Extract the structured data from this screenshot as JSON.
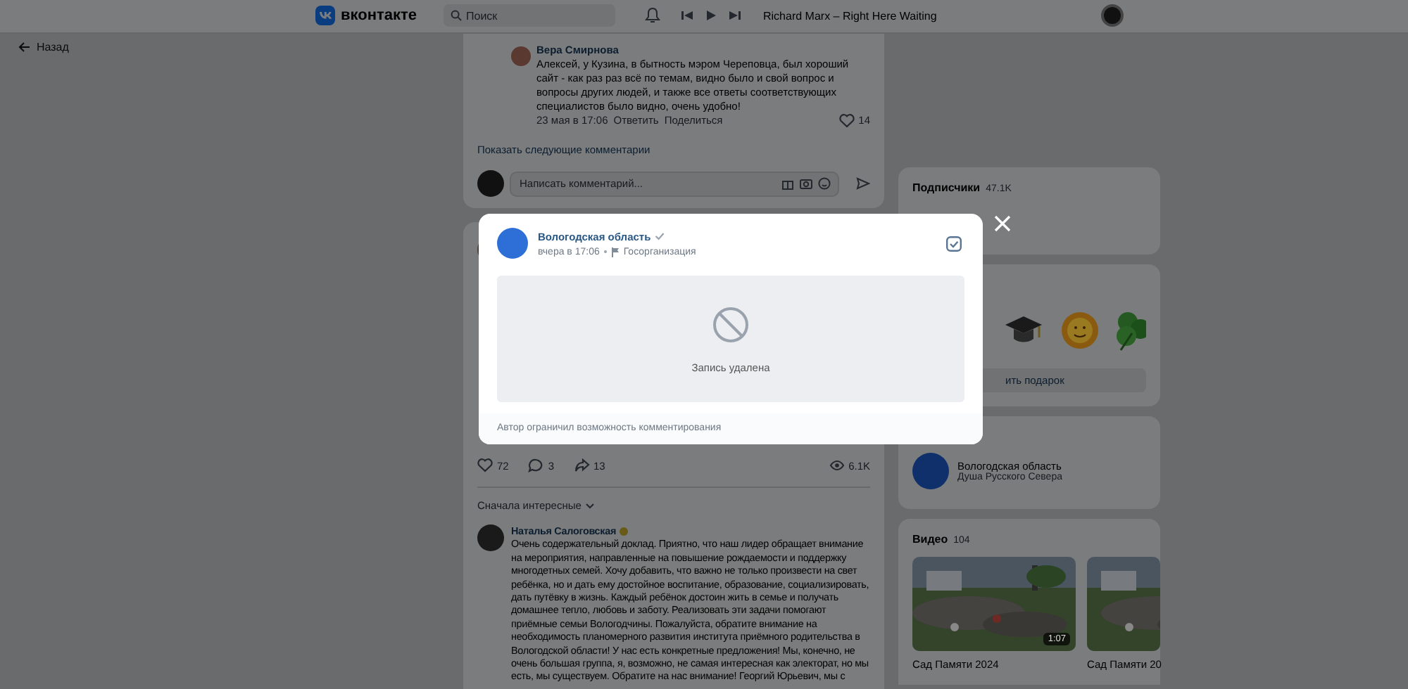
{
  "header": {
    "logo": "вконтакте",
    "search": {
      "placeholder": "Поиск"
    },
    "track": "Richard Marx – Right Here Waiting"
  },
  "back_link": "Назад",
  "reply": {
    "author": "Вера Смирнова",
    "text": "Алексей, у Кузина, в бытность мэром Череповца, был хороший сайт - как раз раз всё по темам, видно было и свой вопрос и вопросы других людей, и также все ответы соответствующих специалистов было видно, очень удобно!",
    "date": "23 мая в 17:06",
    "actions": [
      "Ответить",
      "Поделиться"
    ],
    "likes": "14"
  },
  "show_more": "Показать следующие комментарии",
  "comment_field": {
    "placeholder": "Написать комментарий..."
  },
  "post_stats": [
    {
      "kind": "like",
      "count": "72"
    },
    {
      "kind": "comment",
      "count": "3"
    },
    {
      "kind": "share",
      "count": "13"
    },
    {
      "kind": "views",
      "count": "6.1K"
    }
  ],
  "sort": "Сначала интересные",
  "comment": {
    "author": "Наталья Салоговская",
    "text": "Очень содержательный доклад. Приятно, что наш лидер обращает внимание на мероприятия, направленные на повышение рождаемости и поддержку многодетных семей. Хочу добавить, что важно не только произвести на свет ребёнка, но и дать ему достойное воспитание, образование, социализировать, дать путёвку в жизнь. Каждый ребёнок достоин жить в семье и получать домашнее тепло, любовь и заботу. Реализовать эти задачи помогают приёмные семьи Вологодчины. Пожалуйста, обратите внимание на необходимость планомерного развития института приёмного родительства в Вологодской области! У нас есть конкретные предложения! Мы, конечно, не очень большая группа, я, возможно, не самая интересная как электорат, но мы есть, мы существуем. Обратите на нас внимание! Георгий Юрьевич, мы с"
  },
  "subscribers": {
    "title": "Подписчики",
    "count": "47.1K"
  },
  "gifts": {
    "items": [
      {
        "kind": "cap"
      },
      {
        "kind": "sun"
      },
      {
        "kind": "clover"
      }
    ],
    "button": "ить подарок"
  },
  "group": {
    "name": "Вологодская область",
    "subtitle": "Душа Русского Севера"
  },
  "videos": {
    "title": "Видео",
    "count": "104",
    "items": [
      {
        "title": "Сад Памяти 2024",
        "duration": "1:07"
      },
      {
        "title": "Сад Памяти 20"
      }
    ]
  },
  "modal": {
    "author": "Вологодская область",
    "verified": true,
    "time": "вчера в 17:06",
    "category": "Госорганизация",
    "status": "Запись удалена",
    "footer": "Автор ограничил возможность комментирования"
  }
}
